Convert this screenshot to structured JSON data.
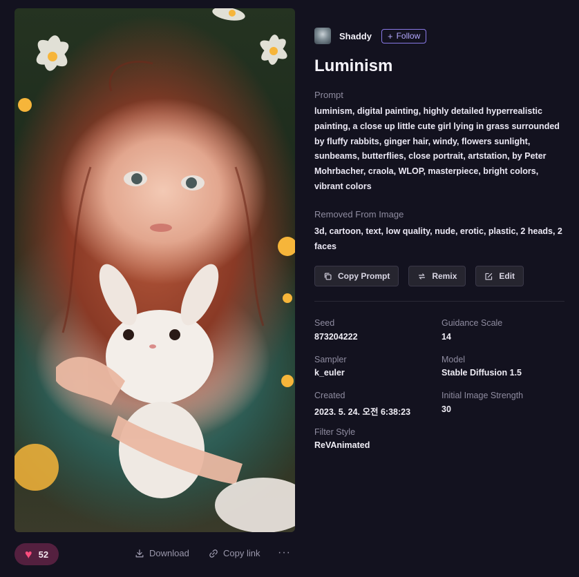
{
  "image": {
    "likes": "52"
  },
  "actions": {
    "download": "Download",
    "copy_link": "Copy link",
    "more": "···"
  },
  "author": {
    "name": "Shaddy",
    "follow": "Follow"
  },
  "title": "Luminism",
  "prompt": {
    "label": "Prompt",
    "text": "luminism, digital painting, highly detailed hyperrealistic painting, a close up little cute girl lying in grass surrounded by fluffy rabbits, ginger hair, windy, flowers sunlight, sunbeams, butterflies, close portrait, artstation, by Peter Mohrbacher, craola, WLOP, masterpiece, bright colors, vibrant colors"
  },
  "negative": {
    "label": "Removed From Image",
    "text": "3d, cartoon, text, low quality, nude, erotic, plastic, 2 heads, 2 faces"
  },
  "buttons": {
    "copy_prompt": "Copy Prompt",
    "remix": "Remix",
    "edit": "Edit"
  },
  "meta": {
    "seed_label": "Seed",
    "seed": "873204222",
    "guidance_label": "Guidance Scale",
    "guidance": "14",
    "sampler_label": "Sampler",
    "sampler": "k_euler",
    "model_label": "Model",
    "model": "Stable Diffusion 1.5",
    "created_label": "Created",
    "created": "2023. 5. 24. 오전 6:38:23",
    "strength_label": "Initial Image Strength",
    "strength": "30",
    "filter_label": "Filter Style",
    "filter": "ReVAnimated"
  },
  "colors": {
    "background": "#13121f",
    "accent": "#8a7ae8",
    "like": "#ff4d7e"
  }
}
